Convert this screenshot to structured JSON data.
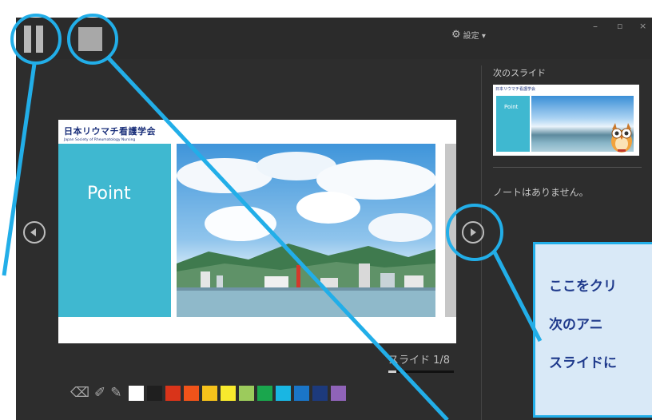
{
  "window": {
    "settings_label": "設定 ▾",
    "minimize_glyph": "–",
    "maximize_glyph": "▫",
    "close_glyph": "×"
  },
  "current_slide": {
    "logo_ja": "日本リウマチ看護学会",
    "logo_en": "Japan Society of Rheumatology Nursing",
    "title": "Point"
  },
  "next_slide": {
    "heading": "次のスライド",
    "thumb_logo": "日本リウマチ看護学会",
    "thumb_title": "Point"
  },
  "notes": "ノートはありません。",
  "counter": "スライド 1/8",
  "progress": 0.125,
  "swatches": [
    "#ffffff",
    "#1f1f1f",
    "#d9341a",
    "#f0531a",
    "#f6c21b",
    "#f8ea2d",
    "#9ccb5c",
    "#1aa64d",
    "#19b6e3",
    "#1a75c7",
    "#1d3a7c",
    "#8f63b8"
  ],
  "callout": {
    "lines": [
      "ここをクリ",
      "次のアニ",
      "スライドに"
    ]
  },
  "colors": {
    "accent": "#22aee8",
    "panel": "#3fb8d0"
  }
}
